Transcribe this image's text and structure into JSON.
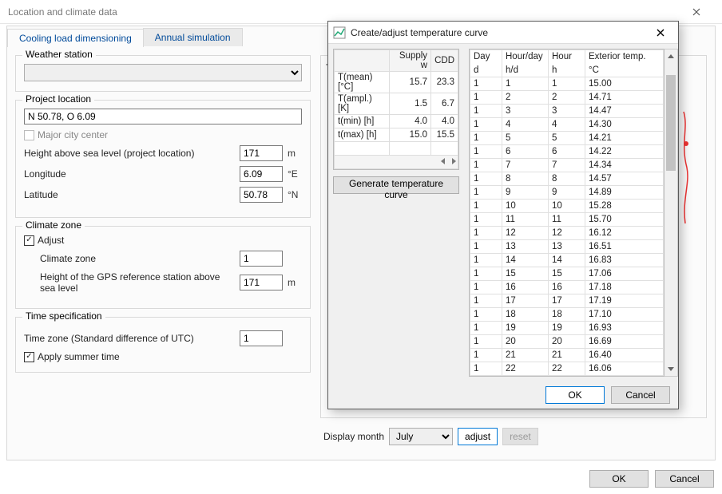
{
  "main_title": "Location and climate data",
  "tabs": {
    "cooling": "Cooling load dimensioning",
    "annual": "Annual simulation"
  },
  "weather_station": {
    "title": "Weather station",
    "value": ""
  },
  "project_location": {
    "title": "Project location",
    "coords": "N 50.78, O 6.09",
    "major_city": "Major city center",
    "height_label": "Height above sea level (project location)",
    "height_value": "171",
    "height_unit": "m",
    "lon_label": "Longitude",
    "lon_value": "6.09",
    "lon_unit": "°E",
    "lat_label": "Latitude",
    "lat_value": "50.78",
    "lat_unit": "°N"
  },
  "climate_zone": {
    "title": "Climate zone",
    "adjust": "Adjust",
    "cz_label": "Climate zone",
    "cz_value": "1",
    "gps_label": "Height of the GPS reference station above sea level",
    "gps_value": "171",
    "gps_unit": "m"
  },
  "time_spec": {
    "title": "Time specification",
    "tz_label": "Time zone (Standard difference of UTC)",
    "tz_value": "1",
    "summer": "Apply summer time"
  },
  "display": {
    "label": "Display month",
    "month": "July",
    "adjust_btn": "adjust",
    "reset_btn": "reset"
  },
  "footer": {
    "ok": "OK",
    "cancel": "Cancel"
  },
  "modal": {
    "title": "Create/adjust temperature curve",
    "param_headers": [
      "Supply w",
      "CDD"
    ],
    "params": [
      {
        "name": "T(mean) [°C]",
        "a": "15.7",
        "b": "23.3"
      },
      {
        "name": "T(ampl.) [K]",
        "a": "1.5",
        "b": "6.7"
      },
      {
        "name": "t(min) [h]",
        "a": "4.0",
        "b": "4.0"
      },
      {
        "name": "t(max) [h]",
        "a": "15.0",
        "b": "15.5"
      }
    ],
    "gen_btn": "Generate temperature curve",
    "col_headers": [
      "Day",
      "Hour/day",
      "Hour",
      "Exterior temp."
    ],
    "col_units": [
      "d",
      "h/d",
      "h",
      "°C"
    ],
    "rows": [
      [
        "1",
        "1",
        "1",
        "15.00"
      ],
      [
        "1",
        "2",
        "2",
        "14.71"
      ],
      [
        "1",
        "3",
        "3",
        "14.47"
      ],
      [
        "1",
        "4",
        "4",
        "14.30"
      ],
      [
        "1",
        "5",
        "5",
        "14.21"
      ],
      [
        "1",
        "6",
        "6",
        "14.22"
      ],
      [
        "1",
        "7",
        "7",
        "14.34"
      ],
      [
        "1",
        "8",
        "8",
        "14.57"
      ],
      [
        "1",
        "9",
        "9",
        "14.89"
      ],
      [
        "1",
        "10",
        "10",
        "15.28"
      ],
      [
        "1",
        "11",
        "11",
        "15.70"
      ],
      [
        "1",
        "12",
        "12",
        "16.12"
      ],
      [
        "1",
        "13",
        "13",
        "16.51"
      ],
      [
        "1",
        "14",
        "14",
        "16.83"
      ],
      [
        "1",
        "15",
        "15",
        "17.06"
      ],
      [
        "1",
        "16",
        "16",
        "17.18"
      ],
      [
        "1",
        "17",
        "17",
        "17.19"
      ],
      [
        "1",
        "18",
        "18",
        "17.10"
      ],
      [
        "1",
        "19",
        "19",
        "16.93"
      ],
      [
        "1",
        "20",
        "20",
        "16.69"
      ],
      [
        "1",
        "21",
        "21",
        "16.40"
      ],
      [
        "1",
        "22",
        "22",
        "16.06"
      ]
    ],
    "ok": "OK",
    "cancel": "Cancel"
  }
}
